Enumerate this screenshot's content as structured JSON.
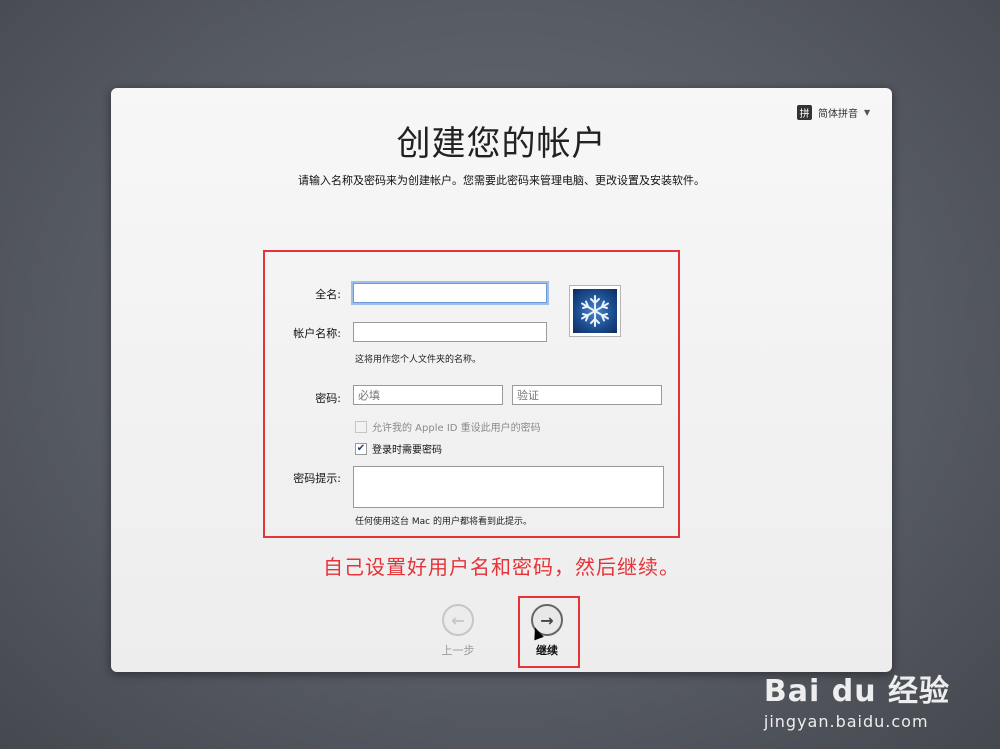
{
  "ime": {
    "icon_label": "拼",
    "label": "简体拼音"
  },
  "title": "创建您的帐户",
  "subtitle": "请输入名称及密码来为创建帐户。您需要此密码来管理电脑、更改设置及安装软件。",
  "form": {
    "full_name_label": "全名:",
    "full_name_value": "",
    "account_name_label": "帐户名称:",
    "account_name_value": "",
    "account_name_hint": "这将用作您个人文件夹的名称。",
    "password_label": "密码:",
    "password_placeholder": "必填",
    "verify_placeholder": "验证",
    "apple_id_reset_label": "允许我的 Apple ID 重设此用户的密码",
    "apple_id_reset_checked": false,
    "require_password_label": "登录时需要密码",
    "require_password_checked": true,
    "hint_label": "密码提示:",
    "hint_value": "",
    "hint_note": "任何使用这台 Mac 的用户都将看到此提示。"
  },
  "annotation": "自己设置好用户名和密码，然后继续。",
  "nav": {
    "back_label": "上一步",
    "next_label": "继续"
  },
  "watermark": {
    "logo": "Bai du 经验",
    "url": "jingyan.baidu.com"
  },
  "colors": {
    "annotation_red": "#e53338",
    "focus_blue": "#6d9bd6"
  }
}
